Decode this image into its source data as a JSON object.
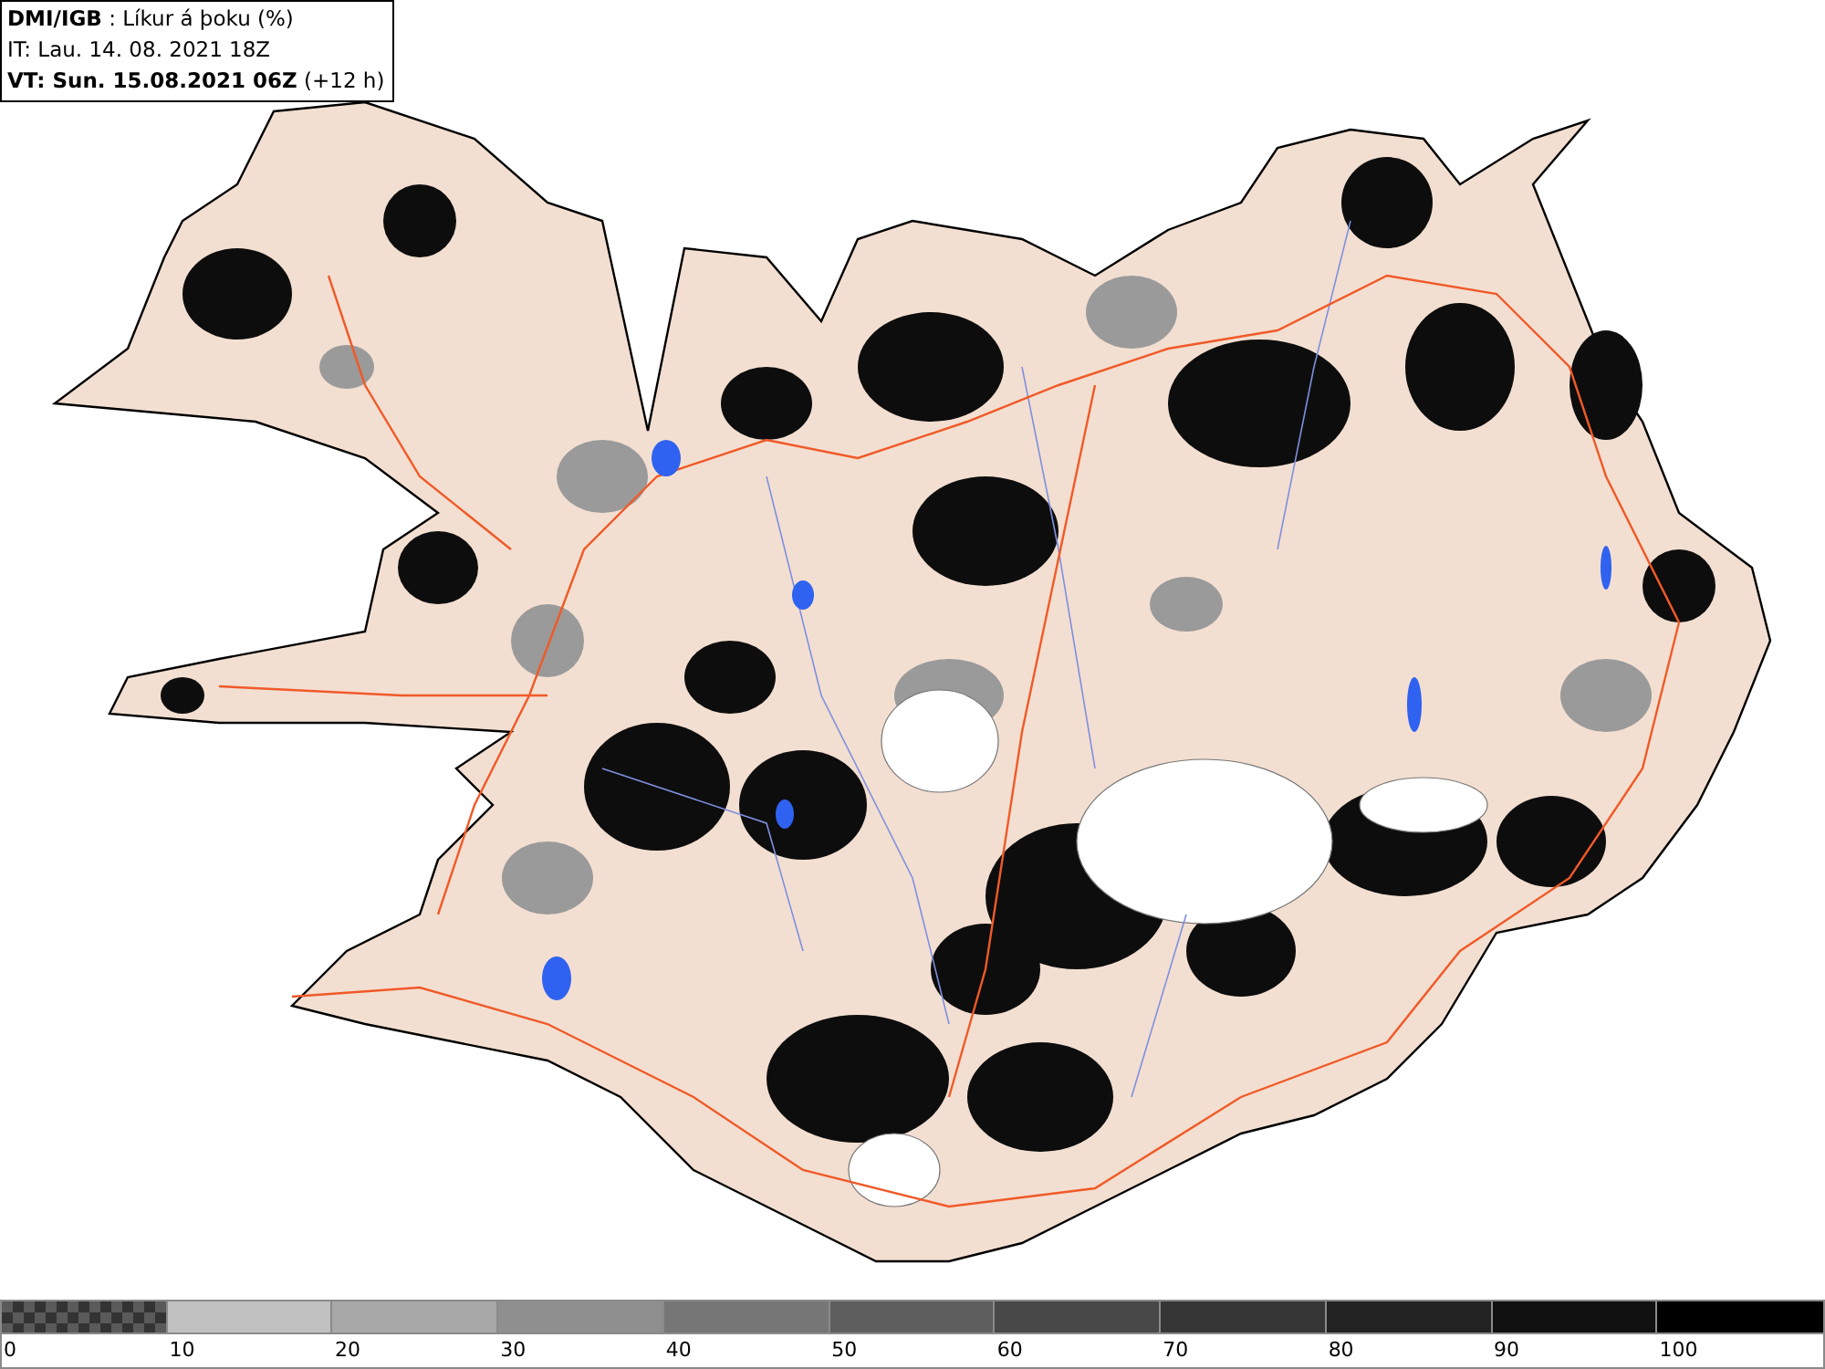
{
  "header": {
    "title": "**DMI/IGB** : Líkur á þoku (%)",
    "issue_time": "IT: Lau. 14. 08. 2021 18Z",
    "valid_time": "**VT: Sun. 15.08.2021 06Z** (+12 h)"
  },
  "legend": {
    "swatches": [
      {
        "kind": "checker",
        "color": "#5a5a5a"
      },
      {
        "kind": "solid",
        "color": "#c0c0c0"
      },
      {
        "kind": "solid",
        "color": "#a8a8a8"
      },
      {
        "kind": "solid",
        "color": "#8f8f8f"
      },
      {
        "kind": "solid",
        "color": "#767676"
      },
      {
        "kind": "solid",
        "color": "#5e5e5e"
      },
      {
        "kind": "solid",
        "color": "#484848"
      },
      {
        "kind": "solid",
        "color": "#363636"
      },
      {
        "kind": "solid",
        "color": "#222222"
      },
      {
        "kind": "solid",
        "color": "#111111"
      },
      {
        "kind": "solid",
        "color": "#000000"
      }
    ],
    "labels": [
      "0",
      "10",
      "20",
      "30",
      "40",
      "50",
      "60",
      "70",
      "80",
      "90",
      "100"
    ]
  }
}
